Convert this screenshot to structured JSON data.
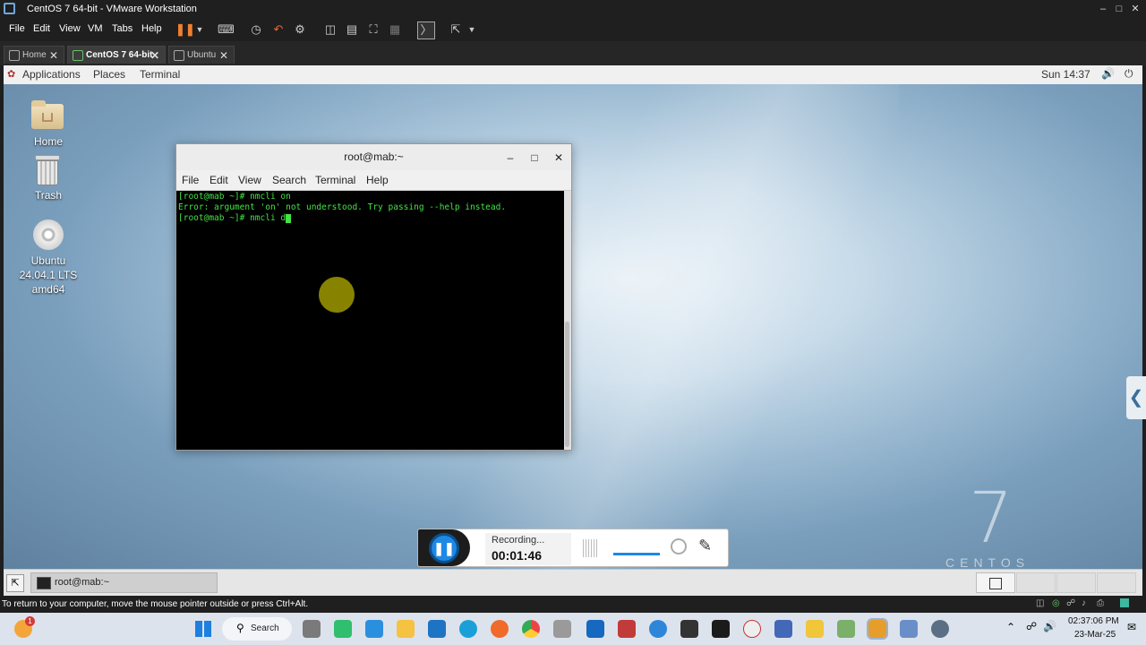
{
  "vmware": {
    "window_title": "CentOS 7 64-bit - VMware Workstation",
    "menus": [
      "File",
      "Edit",
      "View",
      "VM",
      "Tabs",
      "Help"
    ],
    "tabs": [
      {
        "label": "Home",
        "active": false
      },
      {
        "label": "CentOS 7 64-bit",
        "active": true
      },
      {
        "label": "Ubuntu",
        "active": false
      }
    ],
    "status_text": "To return to your computer, move the mouse pointer outside or press Ctrl+Alt."
  },
  "gnome": {
    "topbar": {
      "applications": "Applications",
      "places": "Places",
      "terminal": "Terminal",
      "clock": "Sun 14:37"
    },
    "desktop_icons": [
      {
        "label": "Home"
      },
      {
        "label": "Trash"
      },
      {
        "label": "Ubuntu 24.04.1 LTS amd64"
      }
    ],
    "taskbar_item": "root@mab:~",
    "centos_brand": {
      "number": "7",
      "text": "CENTOS"
    }
  },
  "terminal": {
    "title": "root@mab:~",
    "menus": [
      "File",
      "Edit",
      "View",
      "Search",
      "Terminal",
      "Help"
    ],
    "lines": [
      "[root@mab ~]# nmcli on",
      "Error: argument 'on' not understood. Try passing --help instead.",
      "[root@mab ~]# nmcli d"
    ]
  },
  "recorder": {
    "status": "Recording...",
    "time": "00:01:46"
  },
  "windows": {
    "search_label": "Search",
    "time": "02:37:06 PM",
    "date": "23-Mar-25",
    "notification_count": "1"
  },
  "colors": {
    "terminal_text": "#44e244",
    "accent": "#1e88e5"
  }
}
